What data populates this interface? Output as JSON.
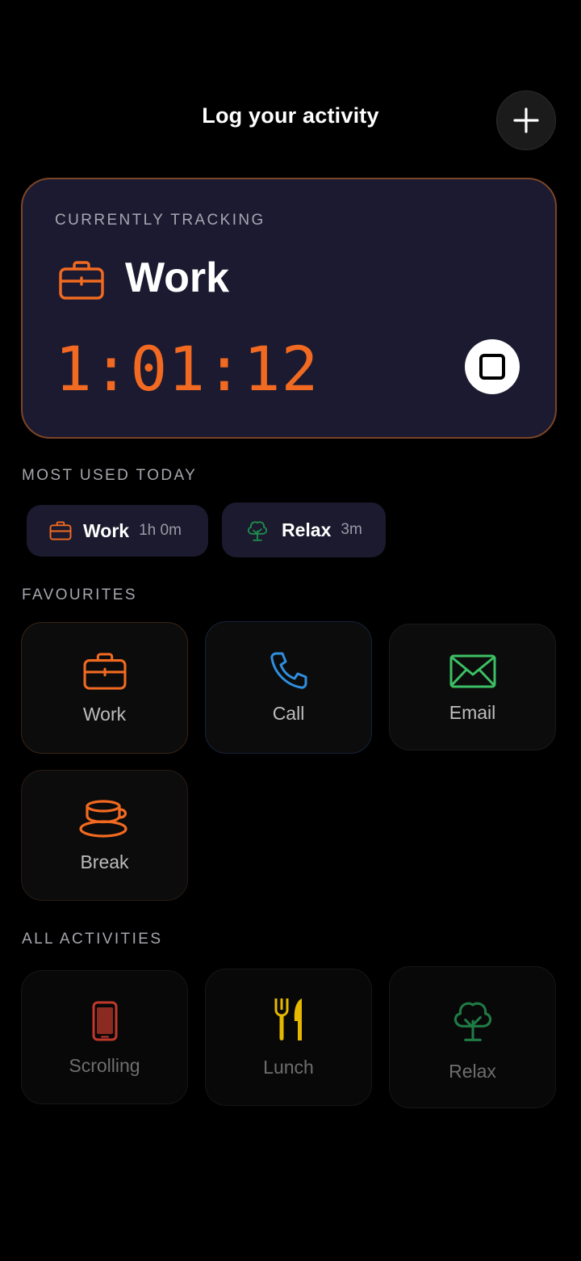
{
  "header": {
    "title": "Log your activity",
    "add_icon": "plus-icon"
  },
  "tracking": {
    "label": "CURRENTLY TRACKING",
    "activity_name": "Work",
    "activity_icon": "briefcase-icon",
    "timer": "1:01:12",
    "stop_icon": "stop-icon",
    "accent_color": "#f26a21",
    "card_color": "#1b1a30"
  },
  "most_used": {
    "label": "MOST USED TODAY",
    "items": [
      {
        "name": "Work",
        "time": "1h 0m",
        "icon": "briefcase-icon",
        "color": "#f26a21"
      },
      {
        "name": "Relax",
        "time": "3m",
        "icon": "tree-icon",
        "color": "#1f8a4c"
      }
    ]
  },
  "favourites": {
    "label": "FAVOURITES",
    "items": [
      {
        "name": "Work",
        "icon": "briefcase-icon",
        "color": "#f26a21"
      },
      {
        "name": "Call",
        "icon": "phone-icon",
        "color": "#2f8fe0"
      },
      {
        "name": "Email",
        "icon": "envelope-icon",
        "color": "#3cc064"
      },
      {
        "name": "Break",
        "icon": "coffee-cup-icon",
        "color": "#f26a21"
      }
    ]
  },
  "all_activities": {
    "label": "ALL ACTIVITIES",
    "items": [
      {
        "name": "Scrolling",
        "icon": "smartphone-icon",
        "color": "#c0392b"
      },
      {
        "name": "Lunch",
        "icon": "fork-knife-icon",
        "color": "#e6b800"
      },
      {
        "name": "Relax",
        "icon": "tree-icon",
        "color": "#1f7a45"
      }
    ]
  }
}
